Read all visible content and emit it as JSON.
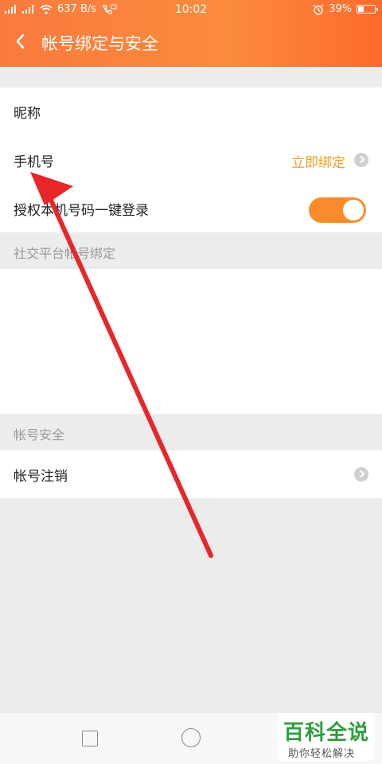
{
  "status_bar": {
    "network_speed": "637 B/s",
    "time": "10:02",
    "battery": "39%",
    "battery_level": 0.39
  },
  "header": {
    "title": "帐号绑定与安全"
  },
  "account_rows": [
    {
      "label": "昵称"
    },
    {
      "label": "手机号",
      "action": "立即绑定"
    },
    {
      "label": "授权本机号码一键登录",
      "toggle_on": true
    }
  ],
  "social_section": {
    "heading": "社交平台帐号绑定"
  },
  "security_section": {
    "heading": "帐号安全",
    "rows": [
      {
        "label": "帐号注销"
      }
    ]
  },
  "watermark": {
    "title": "百科全说",
    "subtitle": "助你轻松解决"
  },
  "colors": {
    "header_gradient_start": "#f97a3e",
    "header_gradient_end": "#fd6a2c",
    "accent": "#f39c21",
    "toggle_on": "#fb8b2a",
    "annotation_arrow": "#e8262a",
    "watermark_green": "#2f9e3e"
  }
}
